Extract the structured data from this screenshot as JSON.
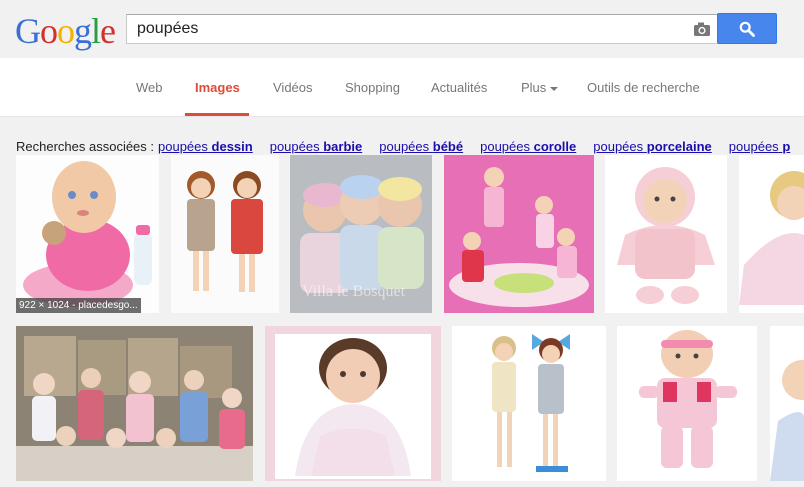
{
  "logo": {
    "letters": [
      "G",
      "o",
      "o",
      "g",
      "l",
      "e"
    ],
    "colors": [
      "#3b6fd6",
      "#d2312b",
      "#f0b400",
      "#3b6fd6",
      "#2a9c43",
      "#d2312b"
    ]
  },
  "search": {
    "query": "poupées",
    "camera_icon": "camera-icon",
    "button_icon": "search-icon"
  },
  "nav": {
    "tabs": [
      {
        "label": "Web"
      },
      {
        "label": "Images",
        "active": true
      },
      {
        "label": "Vidéos"
      },
      {
        "label": "Shopping"
      },
      {
        "label": "Actualités"
      },
      {
        "label": "Plus"
      },
      {
        "label": "Outils de recherche"
      }
    ]
  },
  "related": {
    "label": "Recherches associées :",
    "items": [
      {
        "prefix": "poupées",
        "bold": "dessin"
      },
      {
        "prefix": "poupées",
        "bold": "barbie"
      },
      {
        "prefix": "poupées",
        "bold": "bébé"
      },
      {
        "prefix": "poupées",
        "bold": "corolle"
      },
      {
        "prefix": "poupées",
        "bold": "porcelaine"
      },
      {
        "prefix": "poupées",
        "bold": "p"
      }
    ]
  },
  "results": {
    "first_caption": "922 × 1024 - placedesgo...",
    "watermark": "Villa le Bosquet"
  },
  "colors": {
    "accent": "#dd4b39",
    "link": "#1a0dab",
    "button": "#4787ed"
  }
}
